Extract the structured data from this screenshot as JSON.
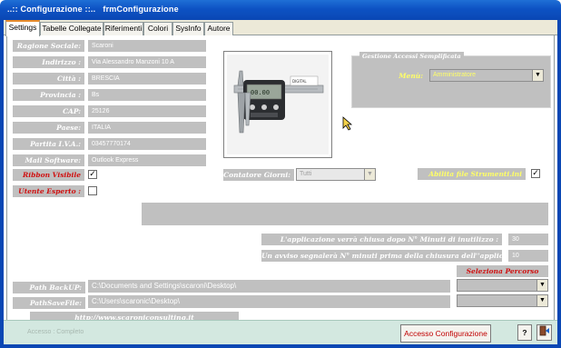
{
  "window": {
    "title": "..:: Configurazione ::..   frmConfigurazione"
  },
  "tabs": [
    {
      "label": "Settings",
      "active": true
    },
    {
      "label": "Tabelle Collegate"
    },
    {
      "label": "Riferimenti"
    },
    {
      "label": "Colori"
    },
    {
      "label": "SysInfo"
    },
    {
      "label": "Autore"
    }
  ],
  "company": {
    "ragione_sociale_label": "Ragione Sociale:",
    "ragione_sociale": "Scaroni",
    "indirizzo_label": "Indirizzo :",
    "indirizzo": "Via Alessandro Manzoni 10 A",
    "citta_label": "Città :",
    "citta": "BRESCIA",
    "provincia_label": "Provincia :",
    "provincia": "Bs",
    "cap_label": "CAP:",
    "cap": "25126",
    "paese_label": "Paese:",
    "paese": "ITALIA",
    "piva_label": "Partita I.V.A.:",
    "piva": "03457770174",
    "mail_label": "Mail Software:",
    "mail": "Outlook Express"
  },
  "flags": {
    "ribbon_label": "Ribbon Visibile",
    "ribbon_checked": true,
    "utente_label": "Utente Esperto :",
    "utente_checked": false,
    "abilita_label": "Abilita  file Strumenti.ini",
    "abilita_checked": true
  },
  "gestione": {
    "title": "Gestione Accessi Semplificata",
    "menu_label": "Menù:",
    "menu_value": "Amministratore"
  },
  "contatore": {
    "label": "Contatore Giorni:",
    "value": "Tutti"
  },
  "timeouts": {
    "chiusura_label": "L'applicazione verrà chiusa dopo N° Minuti di inutilizzo :",
    "chiusura_value": "30",
    "avviso_label": "Un avviso segnalerà N° minuti prima della chiusura dell''applicazione :",
    "avviso_value": "10"
  },
  "paths": {
    "seleziona_label": "Seleziona Percorso",
    "backup_label": "Path BackUP:",
    "backup_value": "C:\\Documents and Settings\\scaroni\\Desktop\\",
    "savefile_label": "PathSaveFile:",
    "savefile_value": "C:\\Users\\scaronic\\Desktop\\"
  },
  "link": "http://www.scaroniconsulting.it",
  "status": {
    "accesso": "Accesso : Completo",
    "config_button": "Accesso Configurazione",
    "help_icon": "question-icon",
    "exit_icon": "exit-door-icon"
  },
  "colors": {
    "titlebar": "#0a47b4",
    "field_bg": "#c0c0c0",
    "red_label": "#d01010",
    "link": "#ffffff"
  }
}
